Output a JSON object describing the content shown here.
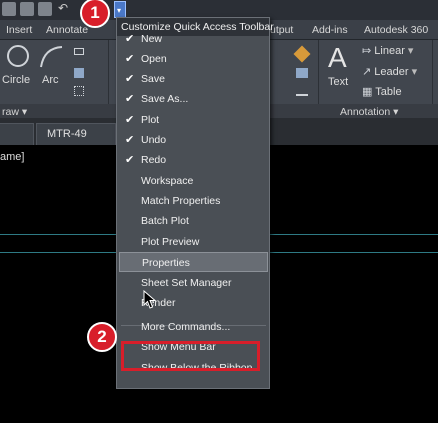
{
  "ribbon_tabs": [
    "Insert",
    "Annotate",
    "utput",
    "Add-ins",
    "Autodesk 360"
  ],
  "ribbon_tools": {
    "circle": "Circle",
    "arc": "Arc",
    "text": "Text",
    "linear": "Linear",
    "leader": "Leader",
    "table": "Table",
    "text_glyph": "A",
    "linear_glyph": "⤇",
    "leader_glyph": "↗",
    "table_glyph": "▦"
  },
  "panel_titles": {
    "draw": "raw",
    "annotation": "Annotation"
  },
  "doc_tab": "MTR-49",
  "command_line": "ame]",
  "menu": {
    "title": "Customize Quick Access Toolbar",
    "checkmark": "✔",
    "items": [
      {
        "label": "New",
        "checked": true
      },
      {
        "label": "Open",
        "checked": true
      },
      {
        "label": "Save",
        "checked": true
      },
      {
        "label": "Save As...",
        "checked": true
      },
      {
        "label": "Plot",
        "checked": true
      },
      {
        "label": "Undo",
        "checked": true
      },
      {
        "label": "Redo",
        "checked": true
      },
      {
        "label": "Workspace",
        "checked": false
      },
      {
        "label": "Match Properties",
        "checked": false
      },
      {
        "label": "Batch Plot",
        "checked": false
      },
      {
        "label": "Plot Preview",
        "checked": false
      },
      {
        "label": "Properties",
        "checked": false,
        "highlighted": true
      },
      {
        "label": "Sheet Set Manager",
        "checked": false
      },
      {
        "label": "Render",
        "checked": false
      },
      {
        "label": "More Commands...",
        "checked": false
      },
      {
        "label": "Show Menu Bar",
        "checked": false,
        "annotated": true
      },
      {
        "label": "Show Below the Ribbon",
        "checked": false
      }
    ]
  },
  "annotations": {
    "step1": "1",
    "step2": "2",
    "highlight_color": "#d81e2a"
  },
  "qat_dropdown_glyph": "▾",
  "colors": {
    "menu_bg": "#4a4f55",
    "ribbon_bg": "#41464e",
    "accent": "#4a78c8"
  }
}
